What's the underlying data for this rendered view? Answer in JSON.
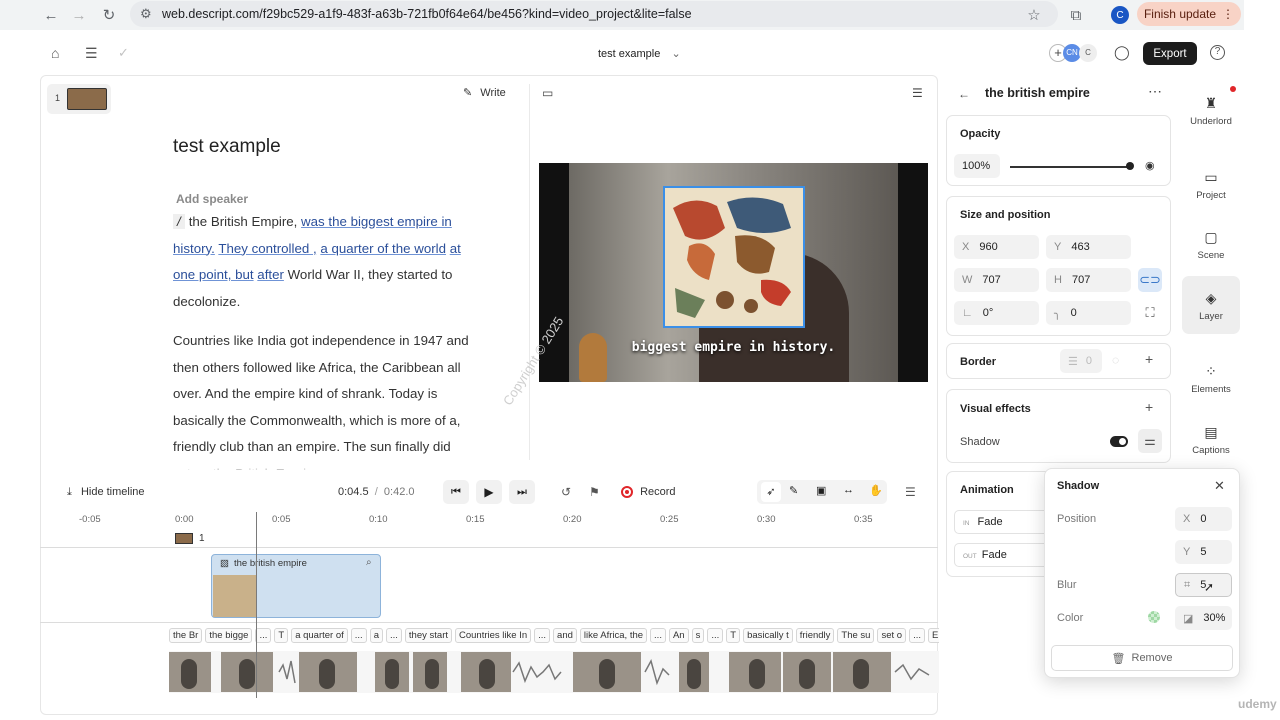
{
  "browser": {
    "url": "web.descript.com/f29bc529-a1f9-483f-a63b-721fb0f64e64/be456?kind=video_project&lite=false",
    "profile_initial": "C",
    "update_label": "Finish update"
  },
  "app": {
    "project_title": "test example",
    "export_label": "Export",
    "collab": [
      "CN",
      "C"
    ]
  },
  "editor": {
    "scene_number": "1",
    "write_label": "Write",
    "doc_title": "test example",
    "add_speaker": "Add speaker",
    "para1": {
      "marker": "/",
      "t1": "the British Empire,",
      "u1": "was the biggest empire in",
      "u2": "history.",
      "u3": "They controlled ,",
      "u4": "a quarter of the world",
      "u5": "at one point, but",
      "u6": "after",
      "t2": "World War II,",
      "t3": "they started to",
      "t4": "decolonize."
    },
    "para2": [
      "Countries like India got independence in 1947 and",
      "then others followed like Africa, the Caribbean all",
      "over. And the empire kind of  shrank. Today is",
      "basically the Commonwealth, which is more of a,",
      "friendly club than an empire. The sun finally did",
      "set on the British Empire."
    ]
  },
  "preview": {
    "caption": "biggest empire in history.",
    "watermark": "Copyright © 2025"
  },
  "timeline": {
    "hide_label": "Hide timeline",
    "current_time": "0:04.5",
    "separator": "/",
    "total_time": "0:42.0",
    "record_label": "Record",
    "ticks": [
      "-0:05",
      "0:00",
      "0:05",
      "0:10",
      "0:15",
      "0:20",
      "0:25",
      "0:30",
      "0:35"
    ],
    "scene_label": "1",
    "clip_label": "the british empire",
    "words": [
      "the Br",
      "the bigge",
      "...",
      "T",
      "a quarter of",
      "...",
      "a",
      "...",
      "they start",
      "Countries like In",
      "...",
      "and",
      "like Africa, the",
      "...",
      "An",
      "s",
      "...",
      "T",
      "basically t",
      "friendly",
      "The su",
      "set o",
      "...",
      "E"
    ]
  },
  "properties": {
    "layer_title": "the british empire",
    "opacity_label": "Opacity",
    "opacity_value": "100%",
    "opacity_fraction": 1.0,
    "size_position_label": "Size and position",
    "x_label": "X",
    "x_value": "960",
    "y_label": "Y",
    "y_value": "463",
    "w_label": "W",
    "w_value": "707",
    "h_label": "H",
    "h_value": "707",
    "rotation_value": "0°",
    "corner_value": "0",
    "border_label": "Border",
    "border_value": "0",
    "visual_effects_label": "Visual effects",
    "shadow_label": "Shadow",
    "animation_label": "Animation",
    "anim_in_tag": "IN",
    "anim_in": "Fade",
    "anim_out_tag": "OUT",
    "anim_out": "Fade"
  },
  "sidenav": [
    {
      "label": "Underlord",
      "icon": "underlord-icon"
    },
    {
      "label": "Project",
      "icon": "folder-icon"
    },
    {
      "label": "Scene",
      "icon": "scene-icon"
    },
    {
      "label": "Layer",
      "icon": "layers-icon"
    },
    {
      "label": "Elements",
      "icon": "elements-icon"
    },
    {
      "label": "Captions",
      "icon": "captions-icon"
    }
  ],
  "shadow_popup": {
    "title": "Shadow",
    "position_label": "Position",
    "x_label": "X",
    "x_value": "0",
    "y_label": "Y",
    "y_value": "5",
    "blur_label": "Blur",
    "blur_value": "5",
    "color_label": "Color",
    "color_opacity": "30%",
    "remove_label": "Remove"
  },
  "corner_watermark": "udemy",
  "colors": {
    "accent": "#3a8fe8",
    "record": "#e0262a",
    "update_bg": "#f8d3c6"
  }
}
